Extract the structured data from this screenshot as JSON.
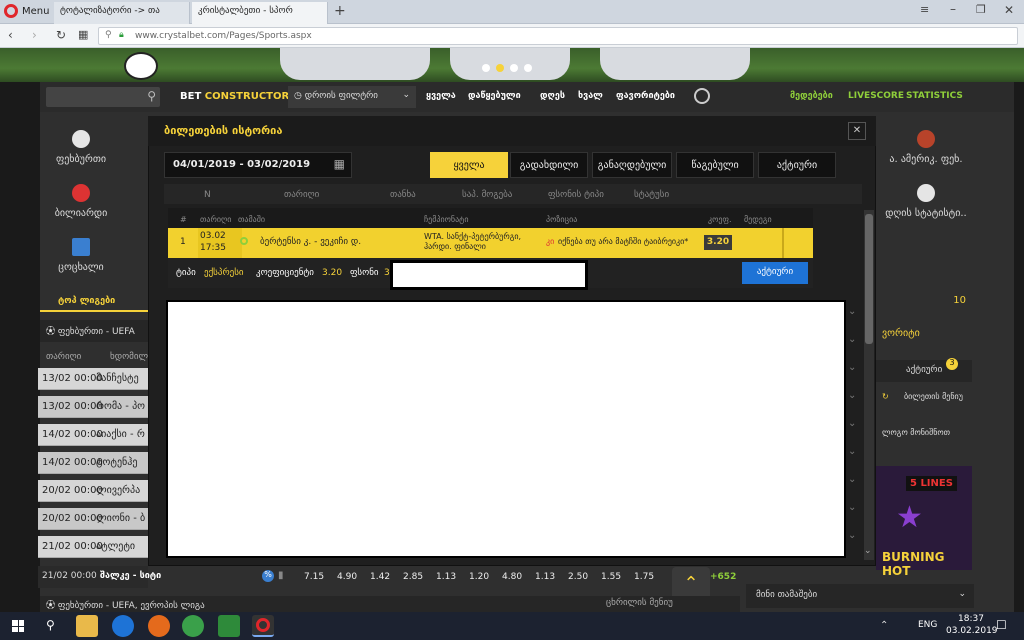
{
  "browser": {
    "menu_label": "Menu",
    "tabs": [
      {
        "label": "ტოტალიზატორი -> თა"
      },
      {
        "label": "კრისტალბეთი - სპორ"
      }
    ],
    "url": "www.crystalbet.com/Pages/Sports.aspx"
  },
  "nav": {
    "brand_bet": "BET",
    "brand_constructor": "CONSTRUCTOR",
    "time_filter": "დროის ფილტრი",
    "tabs": [
      "ყველა",
      "დაწყებული",
      "დღეს",
      "ხვალ",
      "ფავორიტები"
    ],
    "right": [
      "მედებები",
      "LIVESCORE",
      "STATISTICS"
    ]
  },
  "sports_left": [
    {
      "label": "ფეხბურთი"
    },
    {
      "label": "ბილიარდი"
    },
    {
      "label": "ცოცხალი"
    }
  ],
  "sports_right": [
    {
      "label": "ა. ამერიკ. ფეხ."
    },
    {
      "label": "დღის სტატისტი.."
    }
  ],
  "left_panel": {
    "tab_top": "ტოპ ლიგები",
    "league_title": "ფეხბურთი - UEFA",
    "col_date": "თარიღი",
    "col_event": "ხდომილება",
    "rows": [
      {
        "date": "13/02 00:00",
        "event": "მანჩესტე"
      },
      {
        "date": "13/02 00:00",
        "event": "რომა - პო"
      },
      {
        "date": "14/02 00:00",
        "event": "აიაქსი - რ"
      },
      {
        "date": "14/02 00:00",
        "event": "ტოტენჰე"
      },
      {
        "date": "20/02 00:00",
        "event": "ლივერპა"
      },
      {
        "date": "20/02 00:00",
        "event": "ლიონი - ბ"
      },
      {
        "date": "21/02 00:00",
        "event": "ატლეტი"
      },
      {
        "date": "21/02 00:00",
        "event": "შალკე - სიტი"
      }
    ],
    "last_row_odds": [
      "7.15",
      "4.90",
      "1.42",
      "2.85",
      "1.13",
      "1.20",
      "4.80",
      "1.13",
      "2.50",
      "1.55",
      "1.75"
    ],
    "last_row_more": "+652",
    "footer_league": "ფეხბურთი - UEFA, ევროპის ლიგა",
    "footer_right": "ცხრილის მენიუ"
  },
  "right_panel": {
    "count": "10",
    "label_1": "ვორიტი",
    "label_2": "აქტიური",
    "badge": "3",
    "ticket_label": "ბილეთის მენიუ",
    "sub_label": "ლოგო მონიშნოთ",
    "slot_title": "5 LINES",
    "slot_name": "BURNING HOT",
    "mini_games": "მინი თამაშები"
  },
  "modal": {
    "title": "ბილეთების ისტორია",
    "date_range": "04/01/2019 - 03/02/2019",
    "filters": [
      {
        "label": "ყველა",
        "active": true
      },
      {
        "label": "გადახდილი",
        "active": false
      },
      {
        "label": "განაღდებული",
        "active": false
      },
      {
        "label": "წაგებული",
        "active": false
      },
      {
        "label": "აქტიური",
        "active": false
      }
    ],
    "headers": [
      "N",
      "თარიღი",
      "თანხა",
      "საპ. მოგება",
      "ფსონის ტიპი",
      "სტატუსი"
    ],
    "subheaders": [
      "#",
      "თარიღი",
      "თამაში",
      "ჩემპიონატი",
      "პოზიცია",
      "კოეფ.",
      "მედეგი"
    ],
    "bet": {
      "num": "1",
      "date": "03.02",
      "time": "17:35",
      "match": "ბერტენსი კ. - ვეკიჩი დ.",
      "championship": "WTA. სანქტ-პეტერბურგი, ჰარდი. ფინალი",
      "position_code": "კი",
      "position": "იქნება თუ არა მატჩში ტაიბრეიკი*",
      "odds": "3.20"
    },
    "detail": {
      "type_label": "ტიპი",
      "type_value": "ექსპრესი",
      "coef_label": "კოეფიციენტი",
      "coef_value": "3.20",
      "stake_label": "ფსონი",
      "stake_value": "3",
      "status_button": "აქტიური"
    }
  },
  "taskbar": {
    "lang": "ENG",
    "time": "18:37",
    "date": "03.02.2019"
  }
}
